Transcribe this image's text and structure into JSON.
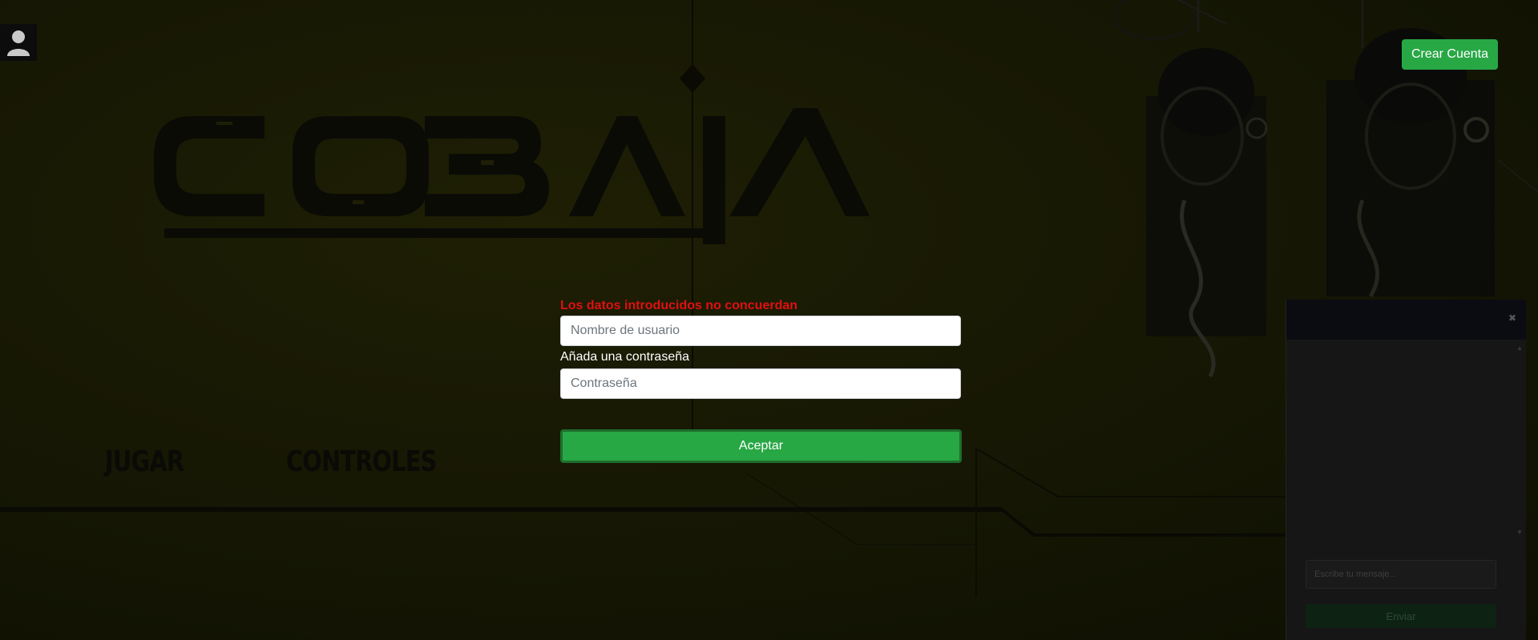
{
  "header": {
    "create_account_label": "Crear Cuenta"
  },
  "brand": {
    "logo_text": "COBAIA",
    "logo_icon": "cobaia-logo"
  },
  "nav": {
    "items": [
      {
        "label": "JUGAR"
      },
      {
        "label": "CONTROLES"
      }
    ]
  },
  "login_form": {
    "error_message": "Los datos introducidos no concuerdan",
    "username_placeholder": "Nombre de usuario",
    "password_label": "Añada una contraseña",
    "password_placeholder": "Contraseña",
    "submit_label": "Aceptar"
  },
  "chat": {
    "close_icon": "close-icon",
    "message_placeholder": "Escribe tu mensaje...",
    "send_label": "Enviar"
  },
  "icons": {
    "user": "user-icon"
  },
  "colors": {
    "accent_green": "#28a745",
    "error_red": "#e01010",
    "background": "#171804"
  }
}
